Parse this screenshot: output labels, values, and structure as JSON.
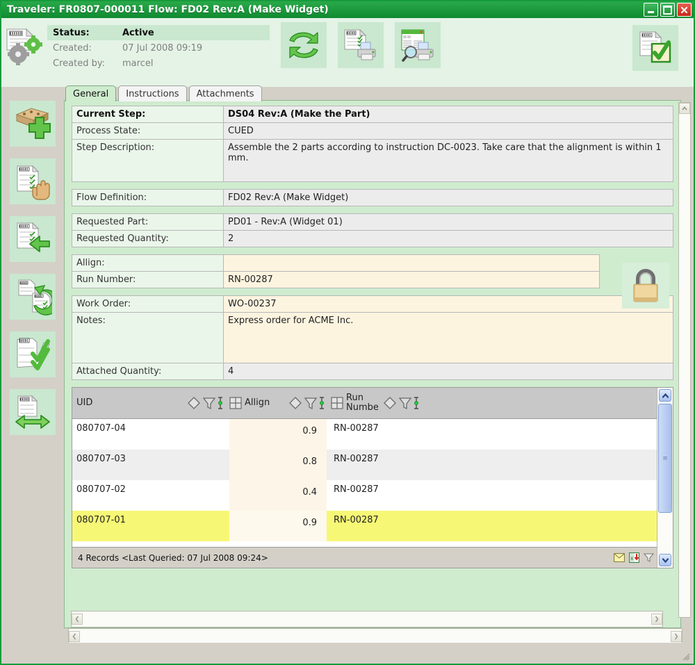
{
  "window": {
    "title": "Traveler: FR0807-000011 Flow: FD02 Rev:A (Make Widget)",
    "minimize_label": "_",
    "maximize_label": "□",
    "close_label": "✕"
  },
  "header": {
    "doc_icon": "traveler-gears-icon",
    "status_label": "Status:",
    "status_value": "Active",
    "created_label": "Created:",
    "created_value": "07 Jul 2008 09:19",
    "created_by_label": "Created by:",
    "created_by_value": "marcel",
    "toolbar": [
      {
        "name": "refresh-button",
        "icon": "refresh-arrows-icon"
      },
      {
        "name": "print-button",
        "icon": "print-traveler-icon"
      },
      {
        "name": "print-preview-button",
        "icon": "print-preview-icon"
      }
    ],
    "right_button": {
      "name": "complete-traveler-button",
      "icon": "document-check-icon"
    }
  },
  "tabs": [
    {
      "label": "General",
      "active": true
    },
    {
      "label": "Instructions",
      "active": false
    },
    {
      "label": "Attachments",
      "active": false
    }
  ],
  "left_toolbar": [
    {
      "name": "add-part-button",
      "icon": "add-part-plus-icon"
    },
    {
      "name": "hold-traveler-button",
      "icon": "traveler-hand-icon"
    },
    {
      "name": "previous-step-button",
      "icon": "traveler-left-arrow-icon"
    },
    {
      "name": "rework-button",
      "icon": "traveler-loop-arrow-icon"
    },
    {
      "name": "signoff-button",
      "icon": "traveler-check-icon"
    },
    {
      "name": "move-traveler-button",
      "icon": "traveler-双-arrow-icon"
    }
  ],
  "form": {
    "groups": [
      {
        "rows": [
          {
            "key": "Current Step:",
            "value": "DS04 Rev:A (Make the Part)",
            "bold": true,
            "style": "grey"
          },
          {
            "key": "Process State:",
            "value": "CUED",
            "bold": false,
            "style": "grey"
          },
          {
            "key": "Step Description:",
            "value": "Assemble the 2 parts according to instruction DC-0023. Take care that the alignment is within 1 mm.",
            "bold": false,
            "style": "grey"
          }
        ]
      },
      {
        "rows": [
          {
            "key": "Flow Definition:",
            "value": "FD02 Rev:A (Make Widget)",
            "bold": false,
            "style": "grey"
          }
        ]
      },
      {
        "rows": [
          {
            "key": "Requested Part:",
            "value": "PD01 - Rev:A (Widget 01)",
            "bold": false,
            "style": "grey"
          },
          {
            "key": "Requested Quantity:",
            "value": "2",
            "bold": false,
            "style": "grey"
          }
        ]
      },
      {
        "rows": [
          {
            "key": "Allign:",
            "value": "",
            "bold": false,
            "style": "cream"
          },
          {
            "key": "Run Number:",
            "value": "RN-00287",
            "bold": false,
            "style": "cream"
          }
        ]
      },
      {
        "rows": [
          {
            "key": "Work Order:",
            "value": "WO-00237",
            "bold": false,
            "style": "cream"
          },
          {
            "key": "Notes:",
            "value": "Express order for ACME Inc.",
            "bold": false,
            "style": "cream"
          },
          {
            "key": "Attached Quantity:",
            "value": "4",
            "bold": false,
            "style": "grey"
          }
        ]
      }
    ],
    "lock_icon": "padlock-locked-icon"
  },
  "grid": {
    "columns": [
      {
        "label": "UID",
        "name": "column-uid"
      },
      {
        "label": "Allign",
        "name": "column-allign"
      },
      {
        "label": "Run Numbe",
        "name": "column-run-number"
      }
    ],
    "header_icons": [
      "sort-diamond-icon",
      "filter-funnel-icon",
      "text-cursor-icon",
      "grid-cells-icon"
    ],
    "rows": [
      {
        "uid": "080707-04",
        "allign": "0.9",
        "run_number": "RN-00287"
      },
      {
        "uid": "080707-03",
        "allign": "0.8",
        "run_number": "RN-00287"
      },
      {
        "uid": "080707-02",
        "allign": "0.4",
        "run_number": "RN-00287"
      },
      {
        "uid": "080707-01",
        "allign": "0.9",
        "run_number": "RN-00287"
      }
    ],
    "status": "4 Records <Last Queried: 07 Jul 2008 09:24>",
    "status_icons": [
      {
        "name": "email-icon"
      },
      {
        "name": "export-excel-icon"
      },
      {
        "name": "filter-icon"
      },
      {
        "name": "refresh-icon"
      }
    ]
  },
  "scrollbars": {
    "up_arrow": "▲",
    "down_arrow": "▼",
    "left_arrow": "‹",
    "right_arrow": "›",
    "grip": "resize-grip-icon"
  },
  "colors": {
    "title_green": "#179b3c",
    "panel_green": "#cfeccf",
    "band_green": "#e4f3e6",
    "cream": "#fdf4e0",
    "selected_yellow": "#f7f776"
  }
}
